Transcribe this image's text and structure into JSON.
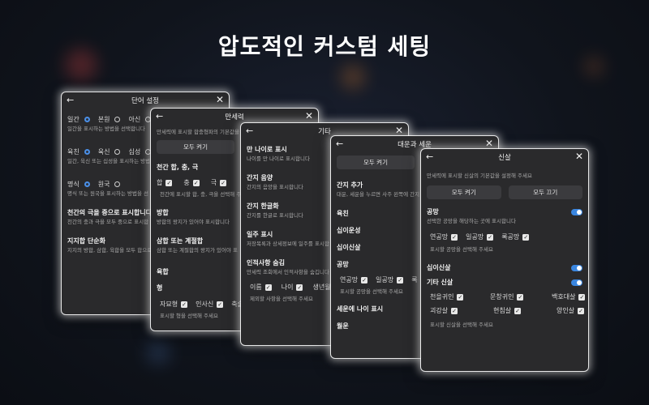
{
  "headline": "압도적인 커스텀 세팅",
  "icons": {
    "back": "arrow-left-icon",
    "close": "close-icon",
    "check": "checkmark-icon"
  },
  "colors": {
    "accent": "#4a8fe7",
    "panel": "#2a2a2c",
    "background": "#10141c"
  },
  "card1": {
    "title": "단어 설정",
    "g1": {
      "o1": "일간",
      "o2": "본원",
      "o3": "아신",
      "desc": "일간을 표시하는 방법을 선택합니다"
    },
    "g2": {
      "o1": "육친",
      "o2": "육신",
      "o3": "십성",
      "desc": "일간, 육신 또는 십성을 표시하는 방법"
    },
    "g3": {
      "o1": "명식",
      "o2": "원국",
      "desc": "명식 또는 원국을 표시하는 방법을 선"
    },
    "s4": {
      "title": "천간의 극을 중으로 표시합니다",
      "desc": "천간의 충과 극을 모두 중으로 표시합"
    },
    "s5": {
      "title": "지지합 단순화",
      "desc": "지지의 방합, 삼합, 육합을 모두 합으로"
    }
  },
  "card2": {
    "title": "만세력",
    "desc": "만세력에 표시할 합충형파의 기본값을",
    "btn": "모두 켜기",
    "s1": "천간 합, 충, 극",
    "checks": {
      "a": "합",
      "b": "충",
      "c": "극"
    },
    "s1desc": "천간에 표시할 합, 충, 극을 선택해 주",
    "s2": {
      "title": "방합",
      "desc": "방합의 왕지가 있어야 표시합니다"
    },
    "s3": {
      "title": "삼합 또는 계절합",
      "desc": "삼합 또는 계절합의 왕지가 있어야 표"
    },
    "s4": "육합",
    "s5": "형",
    "checks2": {
      "a": "자묘형",
      "b": "인사신",
      "c": "축술"
    },
    "s5desc": "표시할 형을 선택해 주세요"
  },
  "card3": {
    "title": "기타",
    "s1": {
      "title": "만 나이로 표시",
      "desc": "나이를 만 나이로 표시합니다"
    },
    "s2": {
      "title": "간지 음양",
      "desc": "간지의 음양을 표시합니다"
    },
    "s3": {
      "title": "간지 한글화",
      "desc": "간지를 한글로 표시합니다"
    },
    "s4": {
      "title": "일주 표시",
      "desc": "저장목록과 상세정보에 일주를 표시합"
    },
    "s5": {
      "title": "인적사항 숨김",
      "desc": "만세력 조회에서 인적사항을 숨깁니다"
    },
    "checks": {
      "a": "이름",
      "b": "나이",
      "c": "생년월일"
    },
    "s5desc2": "제외할 사항을 선택해 주세요"
  },
  "card4": {
    "title": "대운과 세운",
    "btn": "모두 켜기",
    "s1": {
      "title": "간지 추가",
      "desc": "대운, 세운을 누르면 사주 왼쪽에 간지"
    },
    "s2": "육친",
    "s3": "십이운성",
    "s4": "십이신살",
    "s5": "공망",
    "checks": {
      "a": "연공망",
      "b": "일공망",
      "c": "록"
    },
    "s5desc": "표시할 공망을 선택해 주세요",
    "s6": "세운에 나이 표시",
    "s7": "월운"
  },
  "card5": {
    "title": "신살",
    "desc": "만세력에 표시할 신살의 기본값을 설정해 주세요",
    "btn_on": "모두 켜기",
    "btn_off": "모두 끄기",
    "gongmang": {
      "title": "공망",
      "desc": "선택한 공망을 해당하는 곳에 표시합니다",
      "enabled": true
    },
    "gm_checks": {
      "a": "연공망",
      "b": "일공망",
      "c": "록공망"
    },
    "gm_desc": "표시할 공망을 선택해 주세요",
    "sibi": {
      "title": "십이신살",
      "enabled": true
    },
    "etc": {
      "title": "기타 신살",
      "enabled": true
    },
    "etc_checks": {
      "a": "천을귀인",
      "b": "문창귀인",
      "c": "백호대살",
      "d": "괴강살",
      "e": "현침살",
      "f": "양인살"
    },
    "etc_desc": "표시할 신살을 선택해 주세요"
  }
}
